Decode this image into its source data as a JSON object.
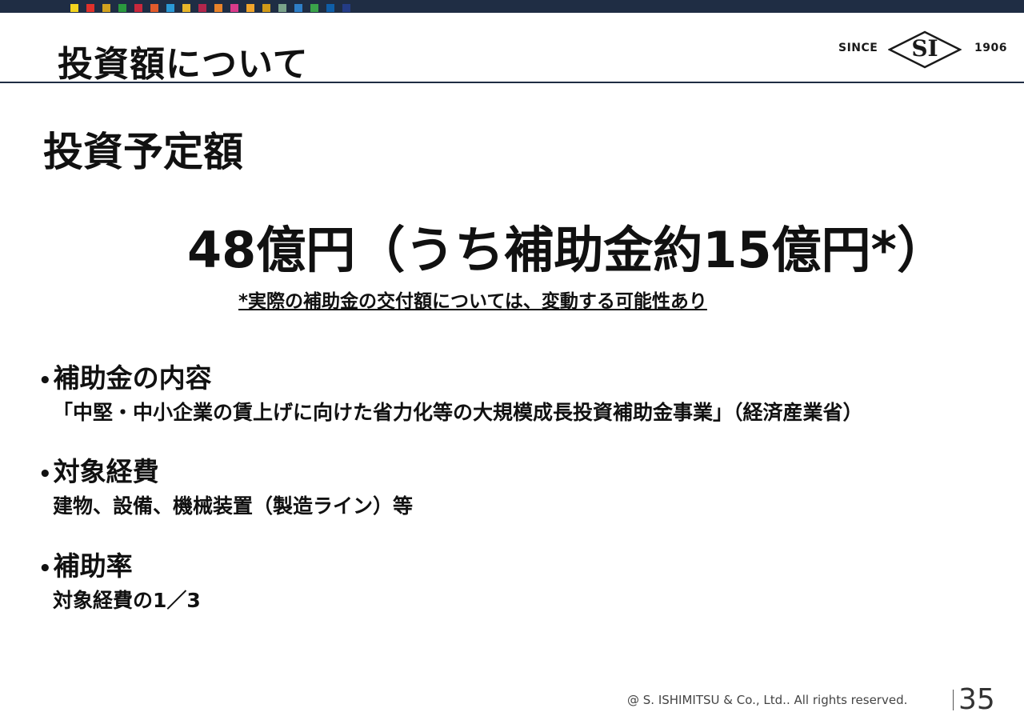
{
  "header": {
    "title": "投資額について",
    "color_strip": [
      "#f2d31f",
      "#e0312b",
      "#d1a21f",
      "#2a9a3e",
      "#c8283c",
      "#e25b2c",
      "#2b9ad6",
      "#e6b52a",
      "#b2264c",
      "#e8832a",
      "#d93b8a",
      "#f0a52b",
      "#cf9a18",
      "#7aa38a",
      "#2e7ec7",
      "#3aa34a",
      "#0f5ea8",
      "#243c86"
    ]
  },
  "logo": {
    "since": "SINCE",
    "mark": "SI",
    "year": "1906"
  },
  "main": {
    "subtitle": "投資予定額",
    "headline": "48億円（うち補助金約15億円*）",
    "footnote": "*実際の補助金の交付額については、変動する可能性あり",
    "bullets": [
      {
        "marker": "•",
        "title": "補助金の内容",
        "body": "「中堅・中小企業の賃上げに向けた省力化等の大規模成長投資補助金事業」（経済産業省）"
      },
      {
        "marker": "•",
        "title": "対象経費",
        "body": "建物、設備、機械装置（製造ライン）等"
      },
      {
        "marker": "•",
        "title": "補助率",
        "body": "対象経費の1／3"
      }
    ]
  },
  "footer": {
    "copyright": "@ S. ISHIMITSU & Co., Ltd.. All rights reserved.",
    "page_number": "35"
  }
}
